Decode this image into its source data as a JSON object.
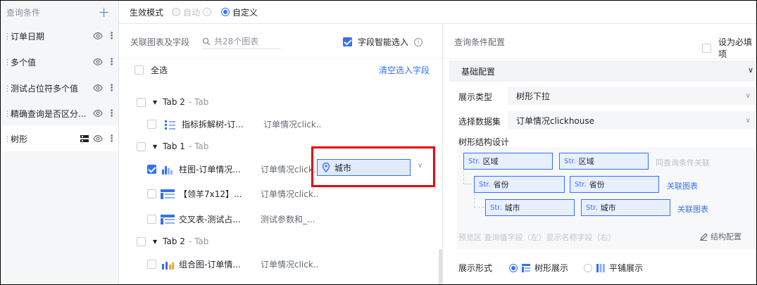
{
  "sidebar": {
    "title": "查询条件",
    "add_label": "+",
    "items": [
      {
        "label": "订单日期"
      },
      {
        "label": "多个值"
      },
      {
        "label": "测试占位符多个值"
      },
      {
        "label": "精确查询是否区分..."
      },
      {
        "label": "树形"
      }
    ]
  },
  "topbar": {
    "mode_label": "生效模式",
    "options": [
      {
        "label": "自动",
        "state": "disabled"
      },
      {
        "label": "自定义",
        "state": "selected"
      }
    ]
  },
  "middle": {
    "title": "关联图表及字段",
    "search_placeholder": "共28个图表",
    "smart_select_label": "字段智能选入",
    "select_all_label": "全选",
    "clear_label": "清空选入字段",
    "rows": [
      {
        "kind": "tab",
        "name": "Tab 2",
        "type": "Tab"
      },
      {
        "kind": "chart",
        "name": "指标拆解树-订...",
        "dataset": "订单情况click...",
        "icon": "indicator-tree-icon",
        "checked": false
      },
      {
        "kind": "tab",
        "name": "Tab 1",
        "type": "Tab"
      },
      {
        "kind": "chart",
        "name": "柱图-订单情况...",
        "dataset": "订单情况click...",
        "icon": "bar-chart-icon",
        "checked": true
      },
      {
        "kind": "chart",
        "name": "【领羊7x12】...",
        "dataset": "订单情况click...",
        "icon": "table-icon",
        "checked": false
      },
      {
        "kind": "chart",
        "name": "交叉表-测试占...",
        "dataset": "测试参数和_...",
        "icon": "table-icon",
        "checked": false
      },
      {
        "kind": "tab",
        "name": "Tab 2",
        "type": "Tab"
      },
      {
        "kind": "chart",
        "name": "组合图-订单情...",
        "dataset": "订单情况click...",
        "icon": "combo-chart-icon",
        "checked": false
      }
    ],
    "selected_field": "城市"
  },
  "right": {
    "title": "查询条件配置",
    "required_label": "设为必填项",
    "basic_label": "基础配置",
    "display_type_label": "展示类型",
    "display_type_value": "树形下拉",
    "dataset_label": "选择数据集",
    "dataset_value": "订单情况clickhouse",
    "tree_title": "树形结构设计",
    "str_tag": "Str.",
    "tree_levels": [
      {
        "query": "区域",
        "display": "区域",
        "link": "同查询条件关联"
      },
      {
        "query": "省份",
        "display": "省份",
        "link": "关联图表"
      },
      {
        "query": "城市",
        "display": "城市",
        "link": "关联图表"
      }
    ],
    "preview_hint": "预览区 查询值字段（左）显示名称字段（右）",
    "struct_config_label": "结构配置",
    "display_form_label": "展示形式",
    "display_forms": [
      {
        "label": "树形展示",
        "state": "selected"
      },
      {
        "label": "平铺展示",
        "state": "unselected"
      }
    ]
  },
  "colors": {
    "accent": "#3370ff",
    "highlight_box": "#e60012"
  }
}
